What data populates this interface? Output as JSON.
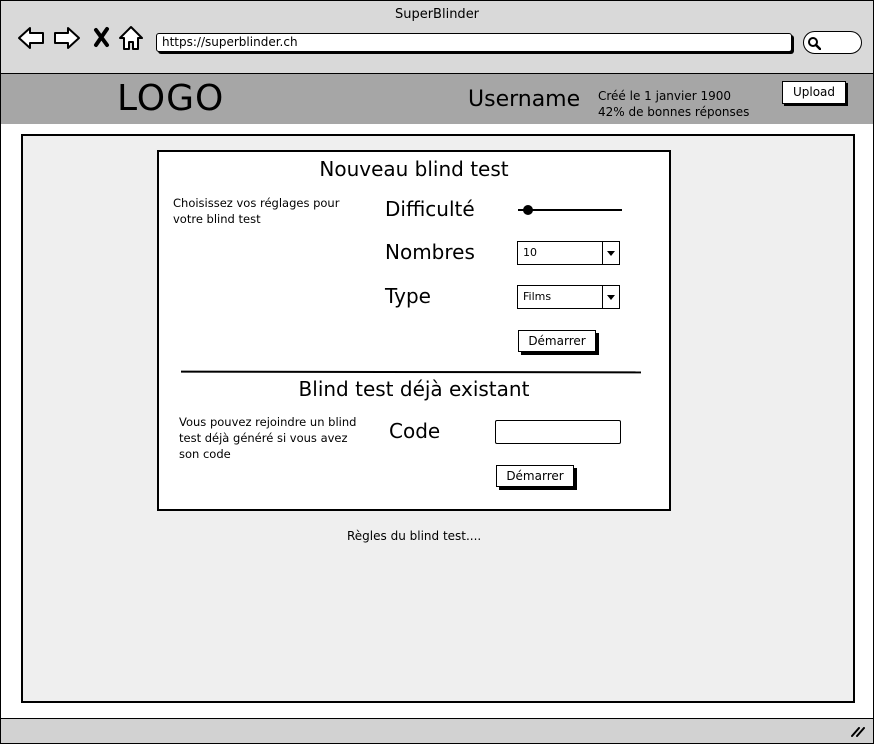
{
  "window": {
    "title": "SuperBlinder",
    "url": "https://superblinder.ch",
    "nav_icons": [
      "back-arrow-icon",
      "forward-arrow-icon",
      "close-x-icon",
      "home-icon"
    ],
    "search_icon": "search-icon"
  },
  "header": {
    "logo": "LOGO",
    "username": "Username",
    "created": "Créé le 1 janvier 1900",
    "ratio": "42% de bonnes réponses",
    "upload_label": "Upload"
  },
  "new_test": {
    "title": "Nouveau blind test",
    "description": "Choisissez vos réglages pour votre blind test",
    "difficulty_label": "Difficulté",
    "difficulty_level": 0.08,
    "count_label": "Nombres",
    "count_value": "10",
    "type_label": "Type",
    "type_value": "Films",
    "start_label": "Démarrer"
  },
  "existing_test": {
    "title": "Blind test déjà existant",
    "description": "Vous pouvez rejoindre un blind test déjà généré si vous avez son code",
    "code_label": "Code",
    "code_value": "",
    "start_label": "Démarrer"
  },
  "rules_link": "Règles du blind test...."
}
